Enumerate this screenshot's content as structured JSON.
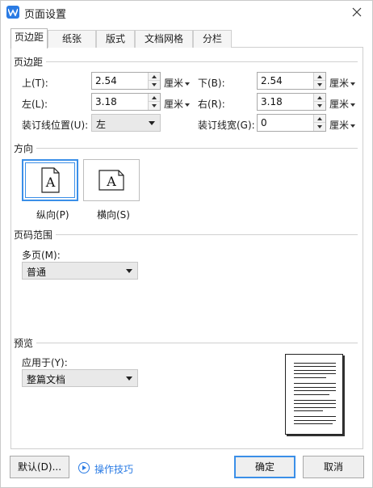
{
  "window": {
    "title": "页面设置"
  },
  "tabs": [
    "页边距",
    "纸张",
    "版式",
    "文档网格",
    "分栏"
  ],
  "margins": {
    "header": "页边距",
    "top": {
      "label": "上(T):",
      "value": "2.54",
      "unit": "厘米"
    },
    "bottom": {
      "label": "下(B):",
      "value": "2.54",
      "unit": "厘米"
    },
    "left": {
      "label": "左(L):",
      "value": "3.18",
      "unit": "厘米"
    },
    "right": {
      "label": "右(R):",
      "value": "3.18",
      "unit": "厘米"
    },
    "gutter_position": {
      "label": "装订线位置(U):",
      "value": "左"
    },
    "gutter_width": {
      "label": "装订线宽(G):",
      "value": "0",
      "unit": "厘米"
    }
  },
  "orientation": {
    "header": "方向",
    "portrait_label": "纵向(P)",
    "landscape_label": "横向(S)",
    "icon_glyph": "A",
    "selected": "portrait"
  },
  "pages": {
    "header": "页码范围",
    "multiple_label": "多页(M):",
    "multiple_value": "普通"
  },
  "preview": {
    "header": "预览",
    "apply_label": "应用于(Y):",
    "apply_value": "整篇文档"
  },
  "footer": {
    "default_button": "默认(D)...",
    "tips_link": "操作技巧",
    "ok_button": "确定",
    "cancel_button": "取消"
  },
  "colors": {
    "accent": "#3b8fe8",
    "logo": "#2a7be4"
  }
}
